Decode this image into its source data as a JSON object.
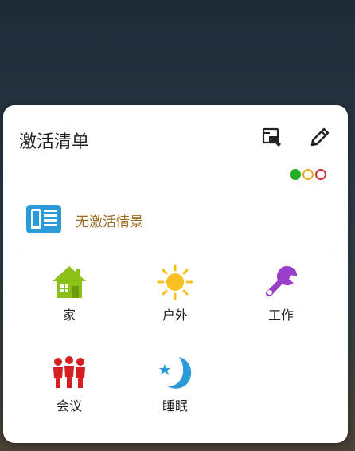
{
  "panel": {
    "title": "激活清单",
    "status_text": "无激活情景",
    "status_dots": [
      "#22b022",
      "#e0b020",
      "#d03030"
    ]
  },
  "header_icons": [
    "edit-layout-icon",
    "pencil-icon"
  ],
  "scenes": [
    {
      "label": "家",
      "icon": "house-icon"
    },
    {
      "label": "户外",
      "icon": "sun-icon"
    },
    {
      "label": "工作",
      "icon": "wrench-icon"
    },
    {
      "label": "会议",
      "icon": "people-icon"
    },
    {
      "label": "睡眠",
      "icon": "moon-star-icon"
    }
  ]
}
